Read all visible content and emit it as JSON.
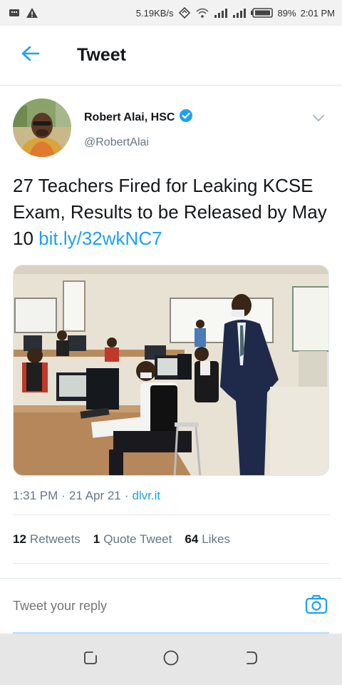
{
  "status_bar": {
    "speed": "5.19KB/s",
    "battery": "89%",
    "time": "2:01 PM"
  },
  "header": {
    "title": "Tweet",
    "back_icon": "arrow-left-icon",
    "accent": "#1da1f2"
  },
  "tweet": {
    "author_name": "Robert Alai, HSC",
    "verified_icon": "verified-badge-icon",
    "handle": "@RobertAlai",
    "text": "27 Teachers Fired for Leaking KCSE Exam, Results to be Released by May 10 ",
    "link": "bit.ly/32wkNC7",
    "time": "1:31 PM",
    "date": "21 Apr 21",
    "source": "dlvr.it",
    "separator": "·"
  },
  "stats": {
    "retweets_count": "12",
    "retweets_label": "Retweets",
    "quotes_count": "1",
    "quotes_label": "Quote Tweet",
    "likes_count": "64",
    "likes_label": "Likes"
  },
  "reply": {
    "placeholder": "Tweet your reply",
    "camera_icon": "camera-icon"
  },
  "nav": {
    "icons": [
      "recent-apps-icon",
      "home-circle-icon",
      "back-nav-icon"
    ]
  }
}
